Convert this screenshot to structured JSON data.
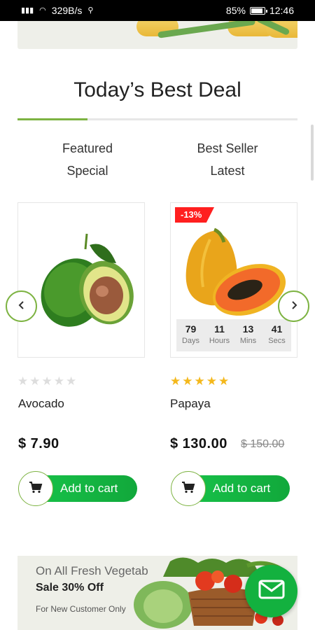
{
  "status_bar": {
    "network_speed": "329B/s",
    "battery_percent": "85%",
    "time": "12:46"
  },
  "section": {
    "title": "Today’s Best Deal",
    "tabs": [
      {
        "line1": "Featured",
        "line2": "Special"
      },
      {
        "line1": "Best Seller",
        "line2": "Latest"
      }
    ]
  },
  "products": [
    {
      "name": "Avocado",
      "price": "$ 7.90",
      "rating": 0,
      "stars": "★★★★★",
      "add_to_cart": "Add to cart"
    },
    {
      "name": "Papaya",
      "price": "$ 130.00",
      "old_price": "$ 150.00",
      "discount_badge": "-13%",
      "rating": 5,
      "stars": "★★★★★",
      "add_to_cart": "Add to cart",
      "countdown": [
        {
          "value": "79",
          "label": "Days"
        },
        {
          "value": "11",
          "label": "Hours"
        },
        {
          "value": "13",
          "label": "Mins"
        },
        {
          "value": "41",
          "label": "Secs"
        }
      ]
    }
  ],
  "promo": {
    "line1": "On All Fresh Vegetab",
    "line2": "Sale 30% Off",
    "line3": "For New Customer Only"
  },
  "colors": {
    "accent_green": "#7db342",
    "button_green": "#13b13f",
    "badge_red": "#ff1f1f",
    "star_gold": "#f4b81c"
  },
  "icons": [
    "wifi-icon",
    "signal-icon",
    "usb-icon",
    "battery-icon",
    "chevron-left-icon",
    "chevron-right-icon",
    "cart-icon",
    "mail-icon"
  ]
}
